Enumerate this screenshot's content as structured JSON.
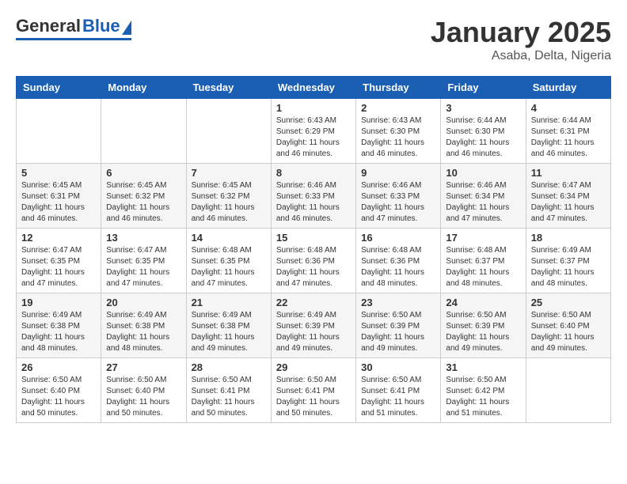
{
  "header": {
    "logo_general": "General",
    "logo_blue": "Blue",
    "month_title": "January 2025",
    "location": "Asaba, Delta, Nigeria"
  },
  "weekdays": [
    "Sunday",
    "Monday",
    "Tuesday",
    "Wednesday",
    "Thursday",
    "Friday",
    "Saturday"
  ],
  "weeks": [
    [
      {
        "day": "",
        "sunrise": "",
        "sunset": "",
        "daylight": ""
      },
      {
        "day": "",
        "sunrise": "",
        "sunset": "",
        "daylight": ""
      },
      {
        "day": "",
        "sunrise": "",
        "sunset": "",
        "daylight": ""
      },
      {
        "day": "1",
        "sunrise": "Sunrise: 6:43 AM",
        "sunset": "Sunset: 6:29 PM",
        "daylight": "Daylight: 11 hours and 46 minutes."
      },
      {
        "day": "2",
        "sunrise": "Sunrise: 6:43 AM",
        "sunset": "Sunset: 6:30 PM",
        "daylight": "Daylight: 11 hours and 46 minutes."
      },
      {
        "day": "3",
        "sunrise": "Sunrise: 6:44 AM",
        "sunset": "Sunset: 6:30 PM",
        "daylight": "Daylight: 11 hours and 46 minutes."
      },
      {
        "day": "4",
        "sunrise": "Sunrise: 6:44 AM",
        "sunset": "Sunset: 6:31 PM",
        "daylight": "Daylight: 11 hours and 46 minutes."
      }
    ],
    [
      {
        "day": "5",
        "sunrise": "Sunrise: 6:45 AM",
        "sunset": "Sunset: 6:31 PM",
        "daylight": "Daylight: 11 hours and 46 minutes."
      },
      {
        "day": "6",
        "sunrise": "Sunrise: 6:45 AM",
        "sunset": "Sunset: 6:32 PM",
        "daylight": "Daylight: 11 hours and 46 minutes."
      },
      {
        "day": "7",
        "sunrise": "Sunrise: 6:45 AM",
        "sunset": "Sunset: 6:32 PM",
        "daylight": "Daylight: 11 hours and 46 minutes."
      },
      {
        "day": "8",
        "sunrise": "Sunrise: 6:46 AM",
        "sunset": "Sunset: 6:33 PM",
        "daylight": "Daylight: 11 hours and 46 minutes."
      },
      {
        "day": "9",
        "sunrise": "Sunrise: 6:46 AM",
        "sunset": "Sunset: 6:33 PM",
        "daylight": "Daylight: 11 hours and 47 minutes."
      },
      {
        "day": "10",
        "sunrise": "Sunrise: 6:46 AM",
        "sunset": "Sunset: 6:34 PM",
        "daylight": "Daylight: 11 hours and 47 minutes."
      },
      {
        "day": "11",
        "sunrise": "Sunrise: 6:47 AM",
        "sunset": "Sunset: 6:34 PM",
        "daylight": "Daylight: 11 hours and 47 minutes."
      }
    ],
    [
      {
        "day": "12",
        "sunrise": "Sunrise: 6:47 AM",
        "sunset": "Sunset: 6:35 PM",
        "daylight": "Daylight: 11 hours and 47 minutes."
      },
      {
        "day": "13",
        "sunrise": "Sunrise: 6:47 AM",
        "sunset": "Sunset: 6:35 PM",
        "daylight": "Daylight: 11 hours and 47 minutes."
      },
      {
        "day": "14",
        "sunrise": "Sunrise: 6:48 AM",
        "sunset": "Sunset: 6:35 PM",
        "daylight": "Daylight: 11 hours and 47 minutes."
      },
      {
        "day": "15",
        "sunrise": "Sunrise: 6:48 AM",
        "sunset": "Sunset: 6:36 PM",
        "daylight": "Daylight: 11 hours and 47 minutes."
      },
      {
        "day": "16",
        "sunrise": "Sunrise: 6:48 AM",
        "sunset": "Sunset: 6:36 PM",
        "daylight": "Daylight: 11 hours and 48 minutes."
      },
      {
        "day": "17",
        "sunrise": "Sunrise: 6:48 AM",
        "sunset": "Sunset: 6:37 PM",
        "daylight": "Daylight: 11 hours and 48 minutes."
      },
      {
        "day": "18",
        "sunrise": "Sunrise: 6:49 AM",
        "sunset": "Sunset: 6:37 PM",
        "daylight": "Daylight: 11 hours and 48 minutes."
      }
    ],
    [
      {
        "day": "19",
        "sunrise": "Sunrise: 6:49 AM",
        "sunset": "Sunset: 6:38 PM",
        "daylight": "Daylight: 11 hours and 48 minutes."
      },
      {
        "day": "20",
        "sunrise": "Sunrise: 6:49 AM",
        "sunset": "Sunset: 6:38 PM",
        "daylight": "Daylight: 11 hours and 48 minutes."
      },
      {
        "day": "21",
        "sunrise": "Sunrise: 6:49 AM",
        "sunset": "Sunset: 6:38 PM",
        "daylight": "Daylight: 11 hours and 49 minutes."
      },
      {
        "day": "22",
        "sunrise": "Sunrise: 6:49 AM",
        "sunset": "Sunset: 6:39 PM",
        "daylight": "Daylight: 11 hours and 49 minutes."
      },
      {
        "day": "23",
        "sunrise": "Sunrise: 6:50 AM",
        "sunset": "Sunset: 6:39 PM",
        "daylight": "Daylight: 11 hours and 49 minutes."
      },
      {
        "day": "24",
        "sunrise": "Sunrise: 6:50 AM",
        "sunset": "Sunset: 6:39 PM",
        "daylight": "Daylight: 11 hours and 49 minutes."
      },
      {
        "day": "25",
        "sunrise": "Sunrise: 6:50 AM",
        "sunset": "Sunset: 6:40 PM",
        "daylight": "Daylight: 11 hours and 49 minutes."
      }
    ],
    [
      {
        "day": "26",
        "sunrise": "Sunrise: 6:50 AM",
        "sunset": "Sunset: 6:40 PM",
        "daylight": "Daylight: 11 hours and 50 minutes."
      },
      {
        "day": "27",
        "sunrise": "Sunrise: 6:50 AM",
        "sunset": "Sunset: 6:40 PM",
        "daylight": "Daylight: 11 hours and 50 minutes."
      },
      {
        "day": "28",
        "sunrise": "Sunrise: 6:50 AM",
        "sunset": "Sunset: 6:41 PM",
        "daylight": "Daylight: 11 hours and 50 minutes."
      },
      {
        "day": "29",
        "sunrise": "Sunrise: 6:50 AM",
        "sunset": "Sunset: 6:41 PM",
        "daylight": "Daylight: 11 hours and 50 minutes."
      },
      {
        "day": "30",
        "sunrise": "Sunrise: 6:50 AM",
        "sunset": "Sunset: 6:41 PM",
        "daylight": "Daylight: 11 hours and 51 minutes."
      },
      {
        "day": "31",
        "sunrise": "Sunrise: 6:50 AM",
        "sunset": "Sunset: 6:42 PM",
        "daylight": "Daylight: 11 hours and 51 minutes."
      },
      {
        "day": "",
        "sunrise": "",
        "sunset": "",
        "daylight": ""
      }
    ]
  ]
}
